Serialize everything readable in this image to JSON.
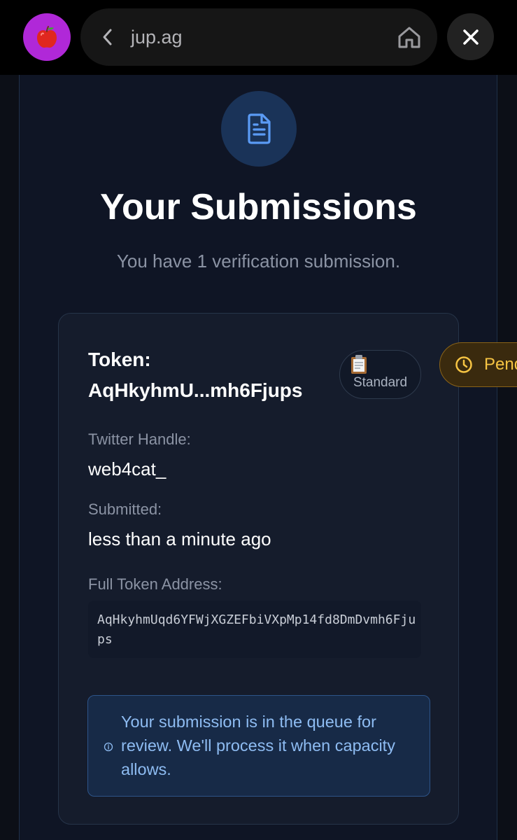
{
  "browser": {
    "site_icon": "apple-emoji-icon",
    "url": "jup.ag",
    "icons": {
      "back": "chevron-left-icon",
      "home": "home-icon",
      "close": "close-icon"
    }
  },
  "page": {
    "header_icon": "document-icon",
    "title": "Your Submissions",
    "subtitle": "You have 1 verification submission."
  },
  "submission": {
    "token_label": "Token:",
    "token_short": "AqHkyhmU...mh6Fjups",
    "badge_icon": "clipboard-emoji-icon",
    "badge_label": "Standard",
    "status_label": "Pending",
    "status_icon": "clock-icon",
    "twitter_label": "Twitter Handle:",
    "twitter_value": "web4cat_",
    "submitted_label": "Submitted:",
    "submitted_value": "less than a minute ago",
    "address_label": "Full Token Address:",
    "address_value": "AqHkyhmUqd6YFWjXGZEFbiVXpMp14fd8DmDvmh6Fjups",
    "notice_icon": "info-icon",
    "notice_text": "Your submission is in the queue for review. We'll process it when capacity allows."
  },
  "colors": {
    "accent_blue": "#5b9bf5",
    "pending_yellow": "#f6c443",
    "site_avatar": "#b028d8"
  }
}
